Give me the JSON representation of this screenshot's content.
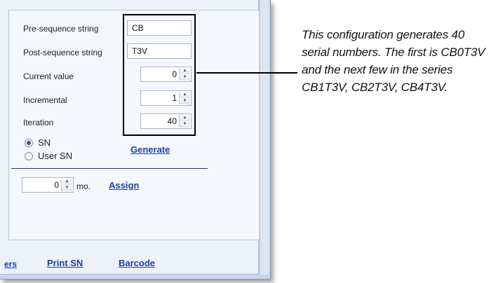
{
  "form": {
    "pre_sequence_label": "Pre-sequence string",
    "pre_sequence_value": "CB",
    "post_sequence_label": "Post-sequence string",
    "post_sequence_value": "T3V",
    "current_value_label": "Current value",
    "current_value": "0",
    "incremental_label": "Incremental",
    "incremental_value": "1",
    "iteration_label": "Iteration",
    "iteration_value": "40",
    "radio_sn_label": "SN",
    "radio_user_sn_label": "User SN",
    "radio_selected": "SN",
    "generate_link": "Generate"
  },
  "assign": {
    "value": "0",
    "unit": "mo.",
    "assign_link": "Assign"
  },
  "footer_links": {
    "partial_link": "ers",
    "print_sn": "Print SN",
    "barcode": "Barcode"
  },
  "callout": {
    "text": "This configuration generates 40 serial numbers. The first is CB0T3V and the next few in the series CB1T3V, CB2T3V, CB4T3V."
  },
  "colors": {
    "link": "#1c3fa8",
    "panel_bg": "#edf2f9",
    "frame_bg": "#c9d7ea"
  }
}
